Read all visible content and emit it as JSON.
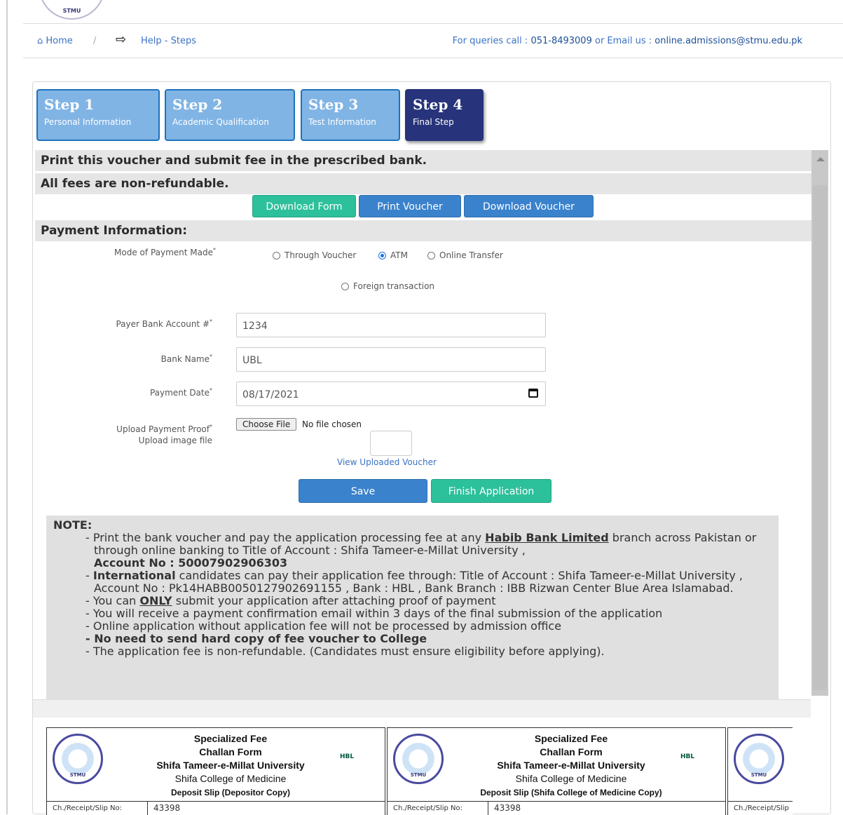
{
  "header": {
    "logo_text": "STMU",
    "breadcrumb": {
      "home": "Home",
      "separator": "/",
      "current": "Help - Steps"
    },
    "queries_prefix": "For queries call :",
    "phone": "051-8493009",
    "email_prefix": "or Email us :",
    "email": "online.admissions@stmu.edu.pk"
  },
  "steps": [
    {
      "title": "Step 1",
      "subtitle": "Personal Information"
    },
    {
      "title": "Step 2",
      "subtitle": "Academic Qualification"
    },
    {
      "title": "Step 3",
      "subtitle": "Test Information"
    },
    {
      "title": "Step 4",
      "subtitle": "Final Step"
    }
  ],
  "banners": {
    "print_notice": "Print this voucher and submit fee in the prescribed bank.",
    "nonrefundable": "All fees are non-refundable.",
    "payment_info": "Payment Information:"
  },
  "buttons": {
    "download_form": "Download Form",
    "print_voucher": "Print Voucher",
    "download_voucher": "Download Voucher",
    "save": "Save",
    "finish": "Finish Application",
    "choose_file": "Choose File"
  },
  "form": {
    "mode_label": "Mode of Payment Made",
    "payment_modes": [
      "Through Voucher",
      "ATM",
      "Online Transfer",
      "Foreign transaction"
    ],
    "selected_mode": "ATM",
    "account_label": "Payer Bank Account #",
    "account_value": "1234",
    "bank_label": "Bank Name",
    "bank_value": "UBL",
    "date_label": "Payment Date",
    "date_value": "08/17/2021",
    "upload_label": "Upload Payment Proof",
    "upload_sub": "Upload image file",
    "no_file": "No file chosen",
    "view_link": "View Uploaded Voucher"
  },
  "note": {
    "heading": "NOTE:",
    "l1a": "- Print the bank voucher and pay the application processing fee at any ",
    "l1bank": "Habib Bank Limited",
    "l1b": " branch across Pakistan or through online banking to Title of Account : Shifa Tameer-e-Millat University ,",
    "l1acct": "Account No : 50007902906303",
    "l2a": "International",
    "l2b": " candidates can pay their application fee through: Title of Account : Shifa Tameer-e-Millat University , Account No : Pk14HABB0050127902691155 , Bank : HBL , Bank Branch : IBB Rizwan Center Blue Area Islamabad.",
    "l3a": "- You can ",
    "l3only": "ONLY",
    "l3b": " submit your application after attaching proof of payment",
    "l4": "- You will receive a payment confirmation email within 3 days of the final submission of the application",
    "l5": "- Online application without application fee will not be processed by admission office",
    "l6": "- No need to send hard copy of fee voucher to College",
    "l7": "- The application fee is non-refundable. (Candidates must ensure eligibility before applying)."
  },
  "vouchers": [
    {
      "t1": "Specialized Fee",
      "t2": "Challan Form",
      "t3": "Shifa Tameer-e-Millat University",
      "t4": "Shifa College of Medicine",
      "t5": "Deposit Slip (Depositor Copy)",
      "bank": "HBL",
      "slip_label": "Ch./Receipt/Slip No:",
      "slip_no": "43398"
    },
    {
      "t1": "Specialized Fee",
      "t2": "Challan Form",
      "t3": "Shifa Tameer-e-Millat University",
      "t4": "Shifa College of Medicine",
      "t5": "Deposit Slip (Shifa College of Medicine Copy)",
      "bank": "HBL",
      "slip_label": "Ch./Receipt/Slip No:",
      "slip_no": "43398"
    },
    {
      "slip_label": "Ch./Receipt/Slip"
    }
  ]
}
